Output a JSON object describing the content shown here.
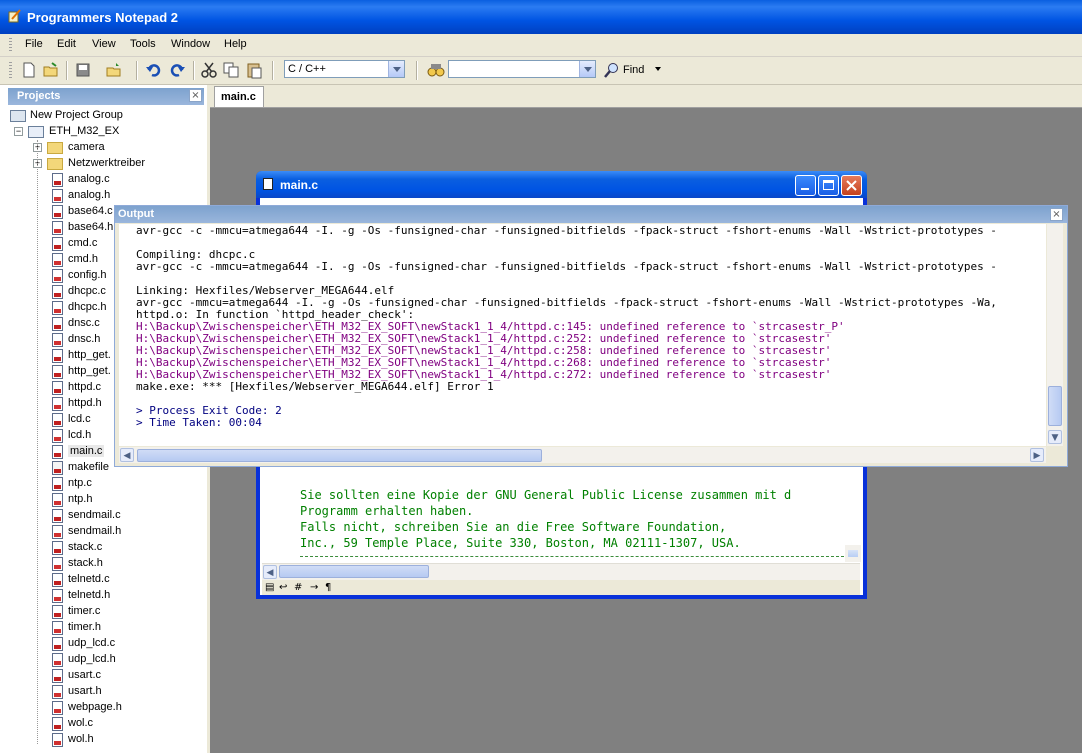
{
  "app": {
    "title": "Programmers Notepad 2"
  },
  "menu": [
    "File",
    "Edit",
    "View",
    "Tools",
    "Window",
    "Help"
  ],
  "toolbar": {
    "language_value": "C / C++",
    "search_value": "",
    "find_label": "Find"
  },
  "projects": {
    "title": "Projects",
    "close_glyph": "×",
    "group": "New Project Group",
    "project": "ETH_M32_EX",
    "folders": [
      "camera",
      "Netzwerktreiber"
    ],
    "files": [
      "analog.c",
      "analog.h",
      "base64.c",
      "base64.h",
      "cmd.c",
      "cmd.h",
      "config.h",
      "dhcpc.c",
      "dhcpc.h",
      "dnsc.c",
      "dnsc.h",
      "http_get.",
      "http_get.",
      "httpd.c",
      "httpd.h",
      "lcd.c",
      "lcd.h",
      "main.c",
      "makefile",
      "ntp.c",
      "ntp.h",
      "sendmail.c",
      "sendmail.h",
      "stack.c",
      "stack.h",
      "telnetd.c",
      "telnetd.h",
      "timer.c",
      "timer.h",
      "udp_lcd.c",
      "udp_lcd.h",
      "usart.c",
      "usart.h",
      "webpage.h",
      "wol.c",
      "wol.h"
    ],
    "selected": "main.c"
  },
  "doc_tab": {
    "label": "main.c"
  },
  "editor": {
    "title": "main.c",
    "lines": [
      "Sie sollten eine Kopie der GNU General Public License zusammen mit d",
      "Programm erhalten haben.",
      "Falls nicht, schreiben Sie an die Free Software Foundation,",
      "Inc., 59 Temple Place, Suite 330, Boston, MA 02111-1307, USA."
    ]
  },
  "output": {
    "title": "Output",
    "close_glyph": "×",
    "lines": [
      {
        "text": "avr-gcc -c -mmcu=atmega644 -I. -g -Os -funsigned-char -funsigned-bitfields -fpack-struct -fshort-enums -Wall -Wstrict-prototypes -",
        "kind": "normal"
      },
      {
        "text": "",
        "kind": "normal"
      },
      {
        "text": "Compiling: dhcpc.c",
        "kind": "normal"
      },
      {
        "text": "avr-gcc -c -mmcu=atmega644 -I. -g -Os -funsigned-char -funsigned-bitfields -fpack-struct -fshort-enums -Wall -Wstrict-prototypes -",
        "kind": "normal"
      },
      {
        "text": "",
        "kind": "normal"
      },
      {
        "text": "Linking: Hexfiles/Webserver_MEGA644.elf",
        "kind": "normal"
      },
      {
        "text": "avr-gcc -mmcu=atmega644 -I. -g -Os -funsigned-char -funsigned-bitfields -fpack-struct -fshort-enums -Wall -Wstrict-prototypes -Wa,",
        "kind": "normal"
      },
      {
        "text": "httpd.o: In function `httpd_header_check':",
        "kind": "normal"
      },
      {
        "text": "H:\\Backup\\Zwischenspeicher\\ETH_M32_EX_SOFT\\newStack1_1_4/httpd.c:145: undefined reference to `strcasestr_P'",
        "kind": "err"
      },
      {
        "text": "H:\\Backup\\Zwischenspeicher\\ETH_M32_EX_SOFT\\newStack1_1_4/httpd.c:252: undefined reference to `strcasestr'",
        "kind": "err"
      },
      {
        "text": "H:\\Backup\\Zwischenspeicher\\ETH_M32_EX_SOFT\\newStack1_1_4/httpd.c:258: undefined reference to `strcasestr'",
        "kind": "err"
      },
      {
        "text": "H:\\Backup\\Zwischenspeicher\\ETH_M32_EX_SOFT\\newStack1_1_4/httpd.c:268: undefined reference to `strcasestr'",
        "kind": "err"
      },
      {
        "text": "H:\\Backup\\Zwischenspeicher\\ETH_M32_EX_SOFT\\newStack1_1_4/httpd.c:272: undefined reference to `strcasestr'",
        "kind": "err"
      },
      {
        "text": "make.exe: *** [Hexfiles/Webserver_MEGA644.elf] Error 1",
        "kind": "normal"
      },
      {
        "text": "",
        "kind": "normal"
      },
      {
        "text": "> Process Exit Code: 2",
        "kind": "info"
      },
      {
        "text": "> Time Taken: 00:04",
        "kind": "info"
      }
    ]
  },
  "colors": {
    "title_blue": "#0054e3",
    "error_text": "#800080",
    "info_text": "#000080",
    "comment_green": "#008000"
  }
}
